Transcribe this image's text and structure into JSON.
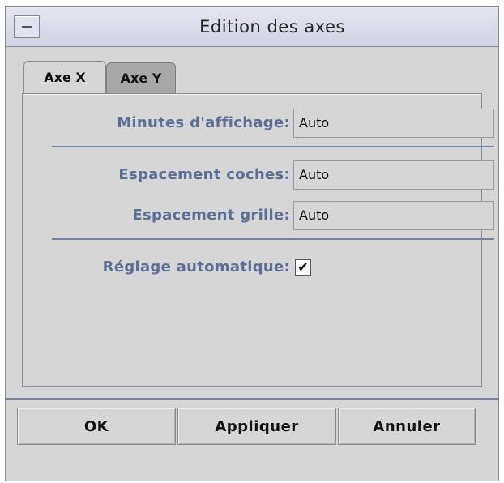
{
  "window": {
    "title": "Edition des axes"
  },
  "tabs": [
    {
      "label": "Axe X",
      "active": true
    },
    {
      "label": "Axe Y",
      "active": false
    }
  ],
  "form": {
    "minutes_label": "Minutes d'affichage:",
    "minutes_value": "Auto",
    "tick_spacing_label": "Espacement coches:",
    "tick_spacing_value": "Auto",
    "grid_spacing_label": "Espacement grille:",
    "grid_spacing_value": "Auto",
    "auto_adjust_label": "Réglage automatique:",
    "auto_adjust_checked": true,
    "check_glyph": "✔"
  },
  "buttons": {
    "ok": "OK",
    "apply": "Appliquer",
    "cancel": "Annuler"
  },
  "colors": {
    "label_text": "#5a6e96",
    "separator": "#6f83a6",
    "background": "#d6d6d6"
  }
}
